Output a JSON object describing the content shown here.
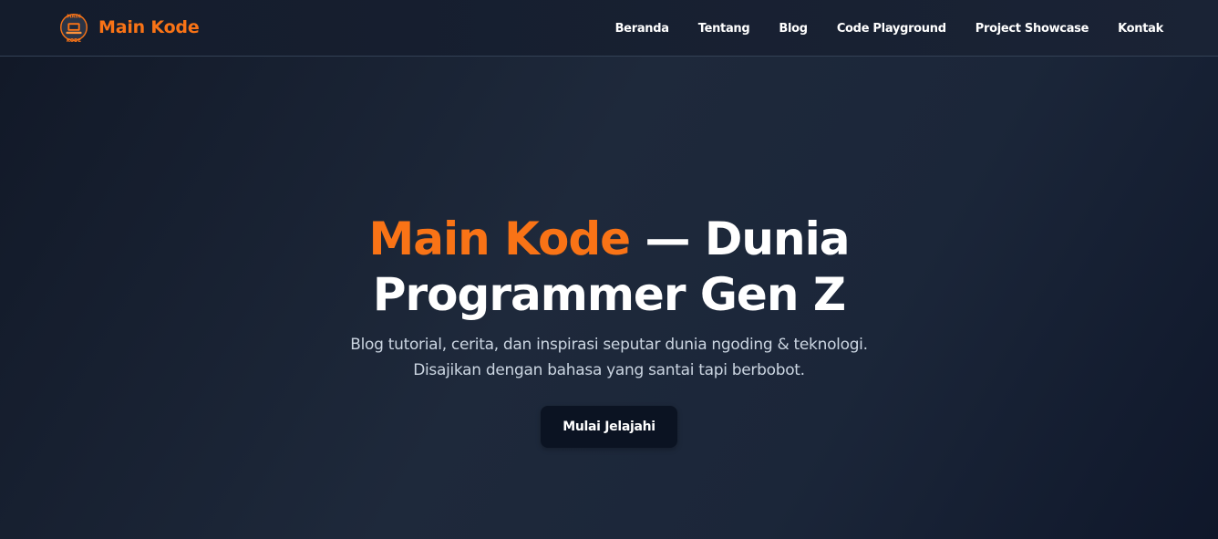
{
  "colors": {
    "accent": "#f97316",
    "background": "#1e293b",
    "button_bg": "#0b1322",
    "subtitle": "#cbd5e1"
  },
  "header": {
    "logo_icon": "main-kode-logo-icon",
    "logo_text": "MAIN KODE",
    "brand": "Main Kode",
    "nav": [
      {
        "label": "Beranda"
      },
      {
        "label": "Tentang"
      },
      {
        "label": "Blog"
      },
      {
        "label": "Code Playground"
      },
      {
        "label": "Project Showcase"
      },
      {
        "label": "Kontak"
      }
    ]
  },
  "hero": {
    "title_accent": "Main Kode",
    "title_rest": " — Dunia Programmer Gen Z",
    "subtitle_line1": "Blog tutorial, cerita, dan inspirasi seputar dunia ngoding & teknologi.",
    "subtitle_line2": "Disajikan dengan bahasa yang santai tapi berbobot.",
    "cta_label": "Mulai Jelajahi"
  }
}
